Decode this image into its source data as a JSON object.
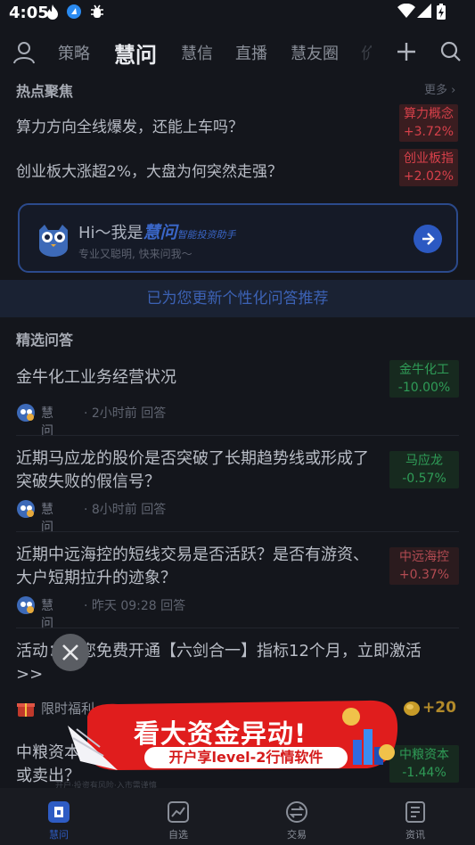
{
  "status_bar": {
    "time": "4:05",
    "icons": [
      "flame-icon",
      "app-icon",
      "bug-icon",
      "wifi-icon",
      "signal-icon",
      "battery-icon"
    ]
  },
  "nav": {
    "tabs": [
      "策略",
      "慧问",
      "慧信",
      "直播",
      "慧友圈",
      "价"
    ],
    "active_tab": "慧问"
  },
  "hot_topics": {
    "title": "热点聚焦",
    "more": "更多",
    "items": [
      {
        "question": "算力方向全线爆发，还能上车吗？",
        "tag": "算力概念",
        "change": "+3.72%"
      },
      {
        "question": "创业板大涨超2%，大盘为何突然走强？",
        "tag": "创业板指",
        "change": "+2.02%"
      }
    ]
  },
  "assistant_card": {
    "greeting": "Hi～我是",
    "brand": "慧问",
    "slogan": "智能投资助手",
    "description": "专业又聪明, 快来问我～"
  },
  "update_banner": "已为您更新个性化问答推荐",
  "featured": {
    "title": "精选问答",
    "items": [
      {
        "question": "金牛化工业务经营状况",
        "answerer": "慧问",
        "time": "· 2小时前 回答",
        "tag": "金牛化工",
        "change": "-10.00%",
        "trend": "down"
      },
      {
        "question": "近期马应龙的股价是否突破了长期趋势线或形成了突破失败的假信号？",
        "answerer": "慧问",
        "time": "· 8小时前 回答",
        "tag": "马应龙",
        "change": "-0.57%",
        "trend": "down"
      },
      {
        "question": "近期中远海控的短线交易是否活跃？是否有游资、大户短期拉升的迹象？",
        "answerer": "慧问",
        "time": "· 昨天 09:28 回答",
        "tag": "中远海控",
        "change": "+0.37%",
        "trend": "up"
      }
    ]
  },
  "promo_item": {
    "text": "活动：为您免费开通【六剑合一】指标12个月，立即激活>>",
    "label": "限时福利",
    "reward": "+20"
  },
  "partial_item": {
    "question": "中粮资本近期是否有主力资金或机构席位大额买入或卖出？",
    "tag": "中粮资本",
    "change": "-1.44%"
  },
  "ad_overlay": {
    "headline": "看大资金异动!",
    "subline": "开户享level-2行情软件",
    "fine_print": "开户·投资有风险·入市需谨慎"
  },
  "tab_bar": {
    "items": [
      {
        "label": "慧问",
        "icon": "ask-icon"
      },
      {
        "label": "自选",
        "icon": "chart-icon"
      },
      {
        "label": "交易",
        "icon": "exchange-icon"
      },
      {
        "label": "资讯",
        "icon": "news-icon"
      }
    ],
    "active": "慧问"
  },
  "colors": {
    "up": "#d6404a",
    "down": "#2f9c57",
    "accent": "#2c59c2",
    "background": "#14161c"
  }
}
